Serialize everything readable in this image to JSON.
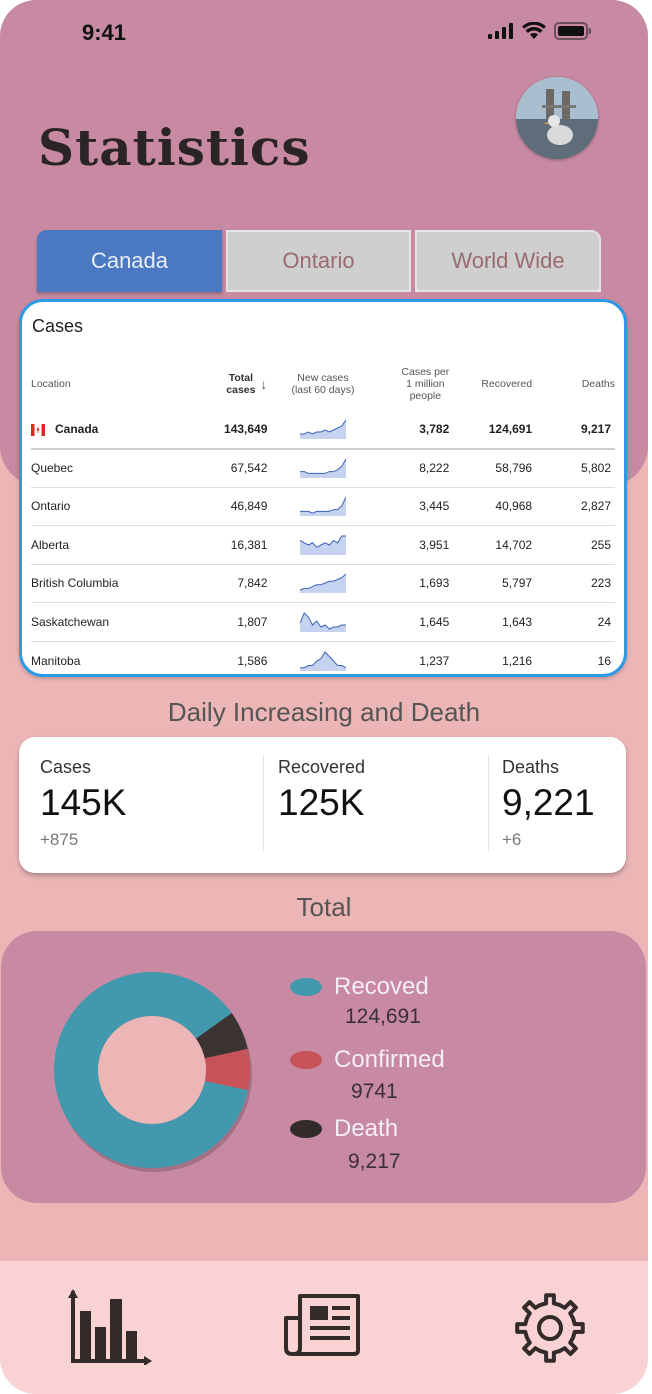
{
  "status_bar": {
    "time": "9:41"
  },
  "header": {
    "title": "Statistics"
  },
  "tabs": [
    {
      "label": "Canada",
      "active": true
    },
    {
      "label": "Ontario",
      "active": false
    },
    {
      "label": "World Wide",
      "active": false
    }
  ],
  "cases_table": {
    "title": "Cases",
    "columns": {
      "location": "Location",
      "total_line1": "Total",
      "total_line2": "cases",
      "new_line1": "New cases",
      "new_line2": "(last 60 days)",
      "per_m_line1": "Cases per",
      "per_m_line2": "1 million",
      "per_m_line3": "people",
      "recovered": "Recovered",
      "deaths": "Deaths"
    },
    "rows": [
      {
        "location": "Canada",
        "total": "143,649",
        "per_million": "3,782",
        "recovered": "124,691",
        "deaths": "9,217",
        "trend": [
          2,
          2,
          3,
          2,
          3,
          3,
          4,
          3,
          4,
          5,
          6,
          9
        ]
      },
      {
        "location": "Quebec",
        "total": "67,542",
        "per_million": "8,222",
        "recovered": "58,796",
        "deaths": "5,802",
        "trend": [
          3,
          3,
          2,
          2,
          2,
          2,
          2,
          3,
          3,
          4,
          6,
          10
        ]
      },
      {
        "location": "Ontario",
        "total": "46,849",
        "per_million": "3,445",
        "recovered": "40,968",
        "deaths": "2,827",
        "trend": [
          2,
          2,
          2,
          1,
          2,
          2,
          2,
          2,
          3,
          3,
          5,
          10
        ]
      },
      {
        "location": "Alberta",
        "total": "16,381",
        "per_million": "3,951",
        "recovered": "14,702",
        "deaths": "255",
        "trend": [
          6,
          5,
          4,
          5,
          3,
          4,
          5,
          4,
          6,
          5,
          8,
          8
        ]
      },
      {
        "location": "British Columbia",
        "total": "7,842",
        "per_million": "1,693",
        "recovered": "5,797",
        "deaths": "223",
        "trend": [
          1,
          2,
          2,
          3,
          4,
          4,
          5,
          6,
          6,
          7,
          8,
          10
        ]
      },
      {
        "location": "Saskatchewan",
        "total": "1,807",
        "per_million": "1,645",
        "recovered": "1,643",
        "deaths": "24",
        "trend": [
          4,
          9,
          7,
          3,
          5,
          2,
          3,
          1,
          2,
          2,
          3,
          3
        ]
      },
      {
        "location": "Manitoba",
        "total": "1,586",
        "per_million": "1,237",
        "recovered": "1,216",
        "deaths": "16",
        "trend": [
          1,
          1,
          2,
          2,
          4,
          5,
          8,
          6,
          4,
          2,
          2,
          1
        ]
      }
    ]
  },
  "daily": {
    "title": "Daily Increasing and Death",
    "cases": {
      "label": "Cases",
      "value": "145K",
      "delta": "+875"
    },
    "recovered": {
      "label": "Recovered",
      "value": "125K",
      "delta": ""
    },
    "deaths": {
      "label": "Deaths",
      "value": "9,221",
      "delta": "+6"
    }
  },
  "total": {
    "title": "Total",
    "legend": [
      {
        "name": "Recoved",
        "value": "124,691",
        "color": "#4298ad"
      },
      {
        "name": "Confirmed",
        "value": "9741",
        "color": "#c65358"
      },
      {
        "name": "Death",
        "value": "9,217",
        "color": "#332a2a"
      }
    ],
    "donut": {
      "type": "pie",
      "categories": [
        "Recoved",
        "Confirmed",
        "Death"
      ],
      "values": [
        124691,
        9741,
        9217
      ],
      "colors": [
        "#4298ad",
        "#c65358",
        "#3c3333"
      ]
    }
  },
  "colors": {
    "tab_active": "#4a78c1",
    "card_border": "#2d9ae8",
    "background": "#ecb6b7",
    "accent_band": "#c88aa2",
    "bottom_bar": "#f9d3d3"
  },
  "nav": [
    {
      "icon": "bar-chart-icon"
    },
    {
      "icon": "newspaper-icon"
    },
    {
      "icon": "gear-icon"
    }
  ]
}
